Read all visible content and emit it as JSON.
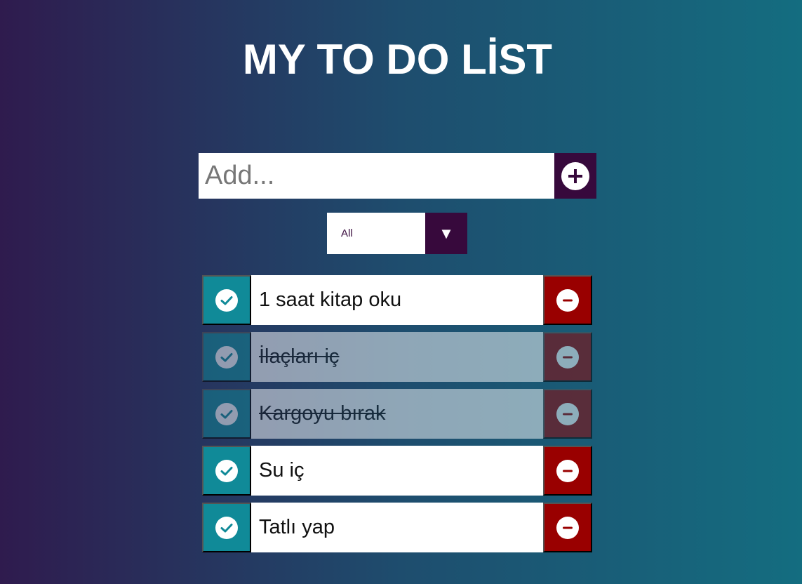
{
  "app": {
    "title": "MY TO DO LİST"
  },
  "add": {
    "placeholder": "Add...",
    "button_icon": "plus-circle-icon"
  },
  "filter": {
    "selected": "All",
    "arrow_icon": "triangle-down-icon",
    "arrow_glyph": "▼"
  },
  "todos": [
    {
      "text": "1 saat kitap oku",
      "completed": false
    },
    {
      "text": "İlaçları iç",
      "completed": true
    },
    {
      "text": "Kargoyu bırak",
      "completed": true
    },
    {
      "text": "Su iç",
      "completed": false
    },
    {
      "text": "Tatlı yap",
      "completed": false
    }
  ],
  "colors": {
    "accent": "#37093c",
    "check": "#108a98",
    "delete": "#990000"
  }
}
